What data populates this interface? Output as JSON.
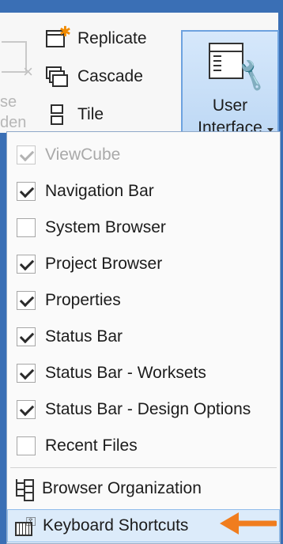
{
  "ribbon": {
    "clipped_button": {
      "line1": "se",
      "line2": "den",
      "icon": "close-hidden-icon"
    },
    "window_commands": [
      {
        "label": "Replicate",
        "icon": "replicate-icon"
      },
      {
        "label": "Cascade",
        "icon": "cascade-icon"
      },
      {
        "label": "Tile",
        "icon": "tile-icon"
      }
    ],
    "user_interface_button": {
      "line1": "User",
      "line2": "Interface",
      "icon": "user-interface-icon"
    }
  },
  "menu": {
    "toggles": [
      {
        "label": "ViewCube",
        "checked": true,
        "enabled": false
      },
      {
        "label": "Navigation Bar",
        "checked": true,
        "enabled": true
      },
      {
        "label": "System Browser",
        "checked": false,
        "enabled": true
      },
      {
        "label": "Project Browser",
        "checked": true,
        "enabled": true
      },
      {
        "label": "Properties",
        "checked": true,
        "enabled": true
      },
      {
        "label": "Status Bar",
        "checked": true,
        "enabled": true
      },
      {
        "label": "Status Bar - Worksets",
        "checked": true,
        "enabled": true
      },
      {
        "label": "Status Bar - Design Options",
        "checked": true,
        "enabled": true
      },
      {
        "label": "Recent Files",
        "checked": false,
        "enabled": true
      }
    ],
    "commands": [
      {
        "label": "Browser Organization",
        "icon": "browser-organization-icon"
      },
      {
        "label": "Keyboard Shortcuts",
        "icon": "keyboard-shortcuts-icon",
        "highlighted": true
      }
    ]
  },
  "colors": {
    "frame": "#3a6fb5",
    "highlight": "#dcebfa",
    "arrow": "#f07d1e"
  }
}
